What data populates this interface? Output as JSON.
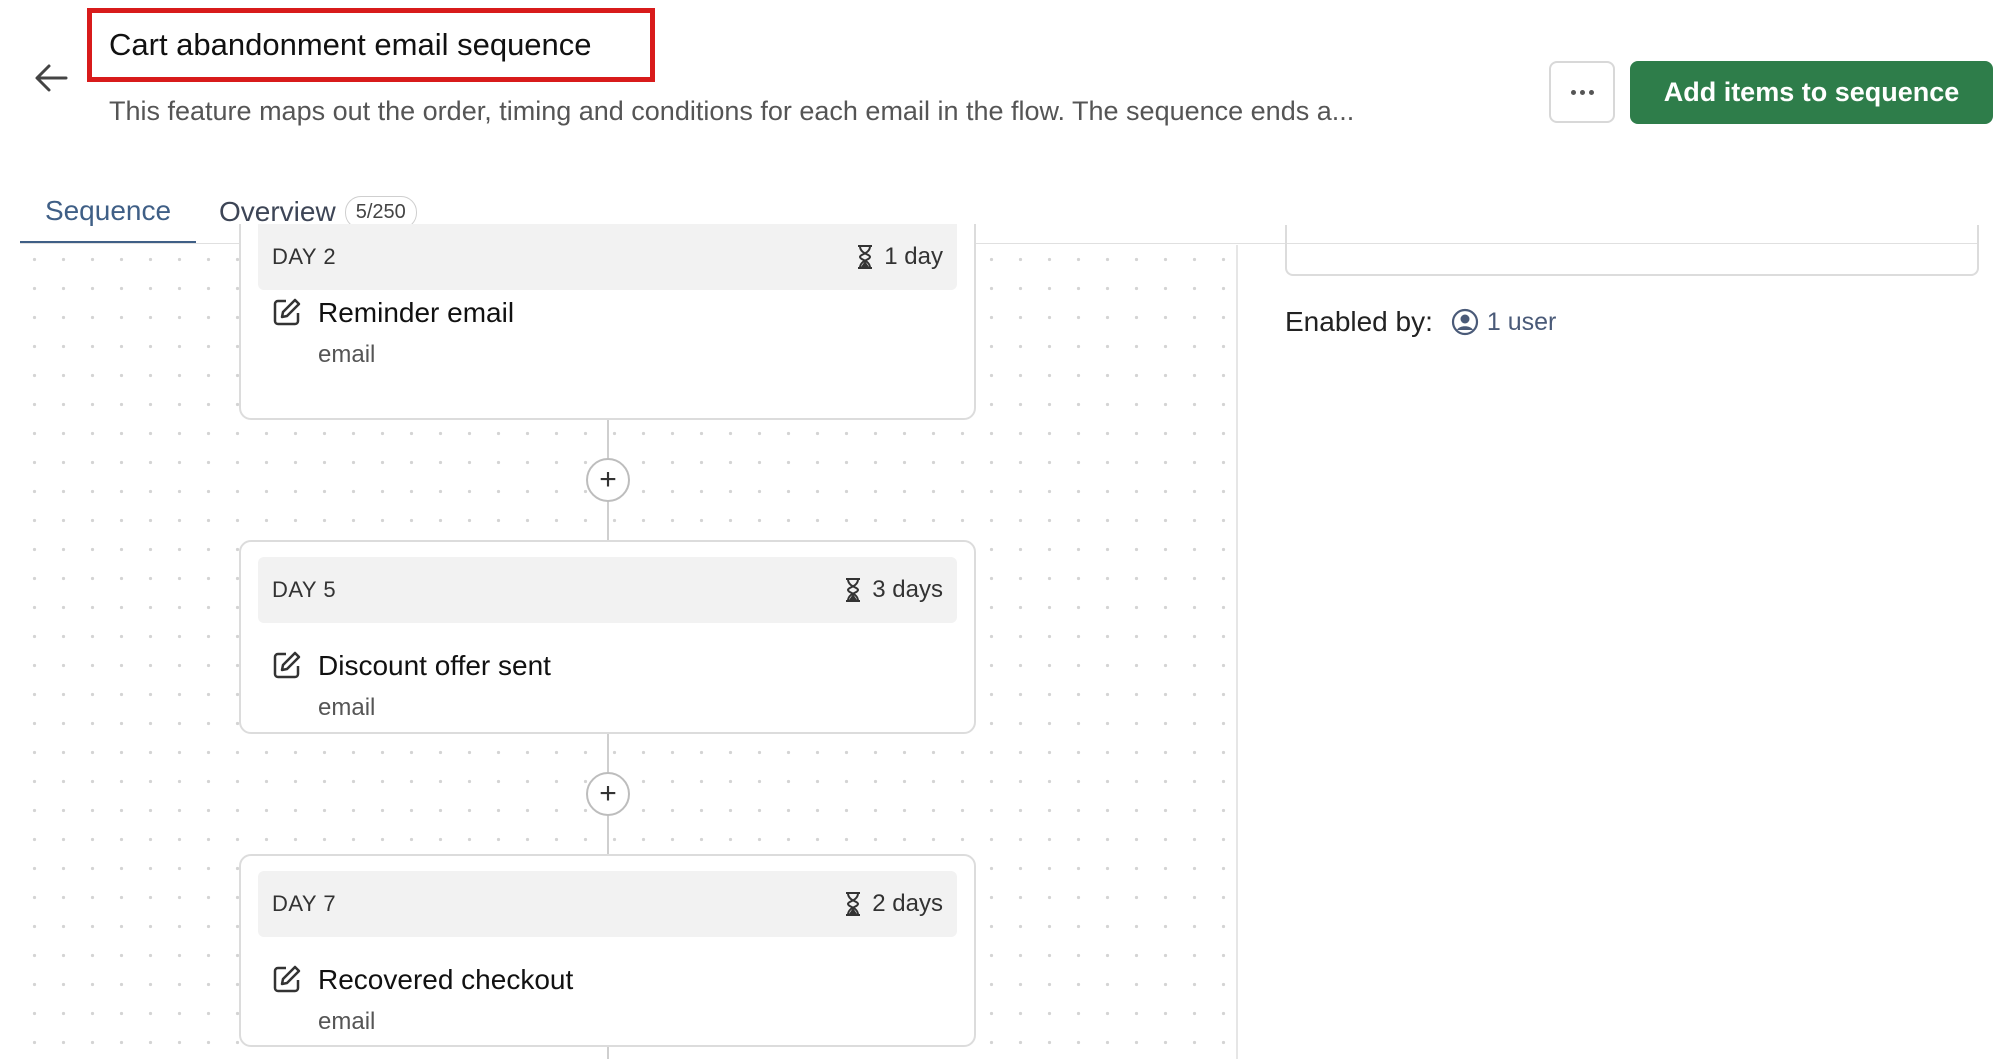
{
  "header": {
    "title": "Cart abandonment email sequence",
    "description": "This feature maps out the order, timing and conditions for each email in the flow. The sequence ends a...",
    "primary_action": "Add items to sequence",
    "back_icon": "arrow-left-icon",
    "more_icon": "ellipsis-icon"
  },
  "tabs": [
    {
      "label": "Sequence",
      "active": true
    },
    {
      "label": "Overview",
      "badge": "5/250",
      "active": false
    }
  ],
  "sequence": {
    "steps": [
      {
        "day": "DAY 2",
        "wait": "1 day",
        "name": "Reminder email",
        "type": "email"
      },
      {
        "day": "DAY 5",
        "wait": "3 days",
        "name": "Discount offer sent",
        "type": "email"
      },
      {
        "day": "DAY 7",
        "wait": "2 days",
        "name": "Recovered checkout",
        "type": "email"
      }
    ],
    "add_label": "+"
  },
  "panel": {
    "enabled_label": "Enabled by:",
    "enabled_value": "1 user"
  },
  "colors": {
    "primary": "#2e7d4a",
    "tab_active": "#3f5f86",
    "highlight": "#d81b1b"
  }
}
